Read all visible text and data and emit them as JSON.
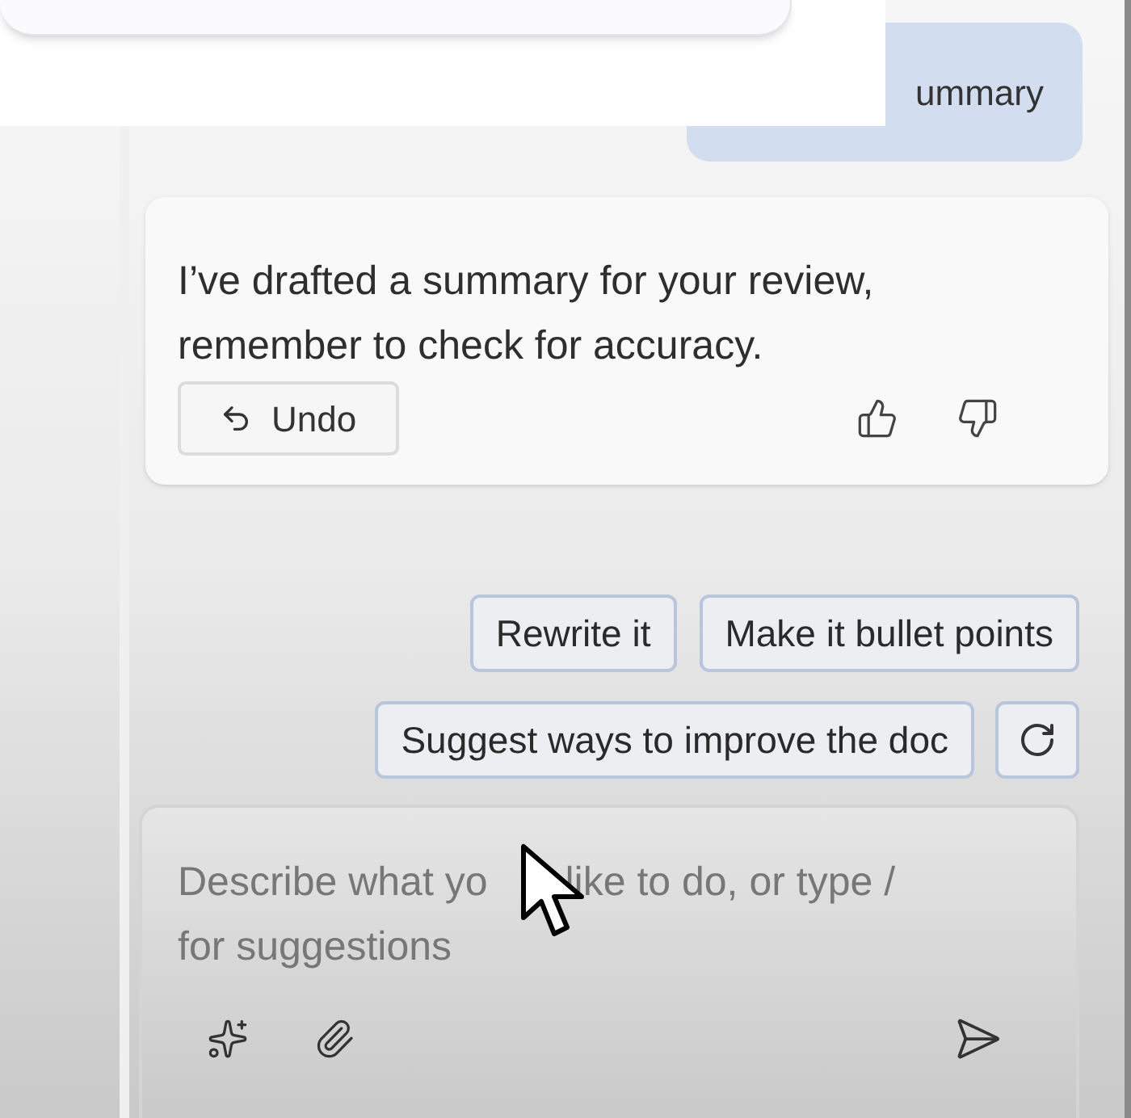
{
  "user_message": {
    "text": "ummary"
  },
  "assistant_message": {
    "text": "I’ve drafted a summary for your review, remember to check for accuracy.",
    "undo_label": "Undo"
  },
  "suggestions": [
    {
      "kind": "text",
      "label": "Rewrite it"
    },
    {
      "kind": "text",
      "label": "Make it bullet points"
    },
    {
      "kind": "text",
      "label": "Suggest ways to improve the doc"
    },
    {
      "kind": "refresh"
    }
  ],
  "composer": {
    "placeholder": [
      "Describe what yo",
      "like to do, or type /",
      "for suggestions"
    ]
  }
}
